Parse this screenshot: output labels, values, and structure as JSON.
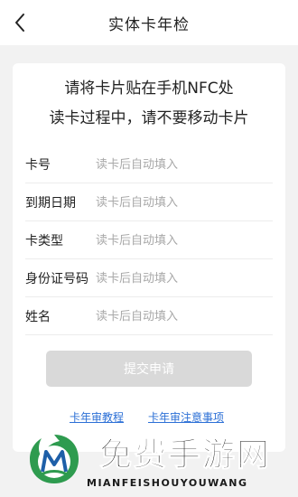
{
  "header": {
    "title": "实体卡年检",
    "back_icon": "chevron-left-icon"
  },
  "prompt": {
    "line1": "请将卡片贴在手机NFC处",
    "line2": "读卡过程中，请不要移动卡片"
  },
  "fields": [
    {
      "label": "卡号",
      "placeholder": "读卡后自动填入"
    },
    {
      "label": "到期日期",
      "placeholder": "读卡后自动填入"
    },
    {
      "label": "卡类型",
      "placeholder": "读卡后自动填入"
    },
    {
      "label": "身份证号码",
      "placeholder": "读卡后自动填入"
    },
    {
      "label": "姓名",
      "placeholder": "读卡后自动填入"
    }
  ],
  "submit_label": "提交申请",
  "links": {
    "tutorial": "卡年审教程",
    "notice": "卡年审注意事项"
  },
  "watermark": {
    "title": "免费手游网",
    "subtitle": "MIANFEISHOUYOUWANG"
  },
  "colors": {
    "link": "#2b6fd6",
    "button_disabled": "#d9d9d9",
    "background": "#f2f2f2",
    "logo_green": "#2e9b4f"
  }
}
